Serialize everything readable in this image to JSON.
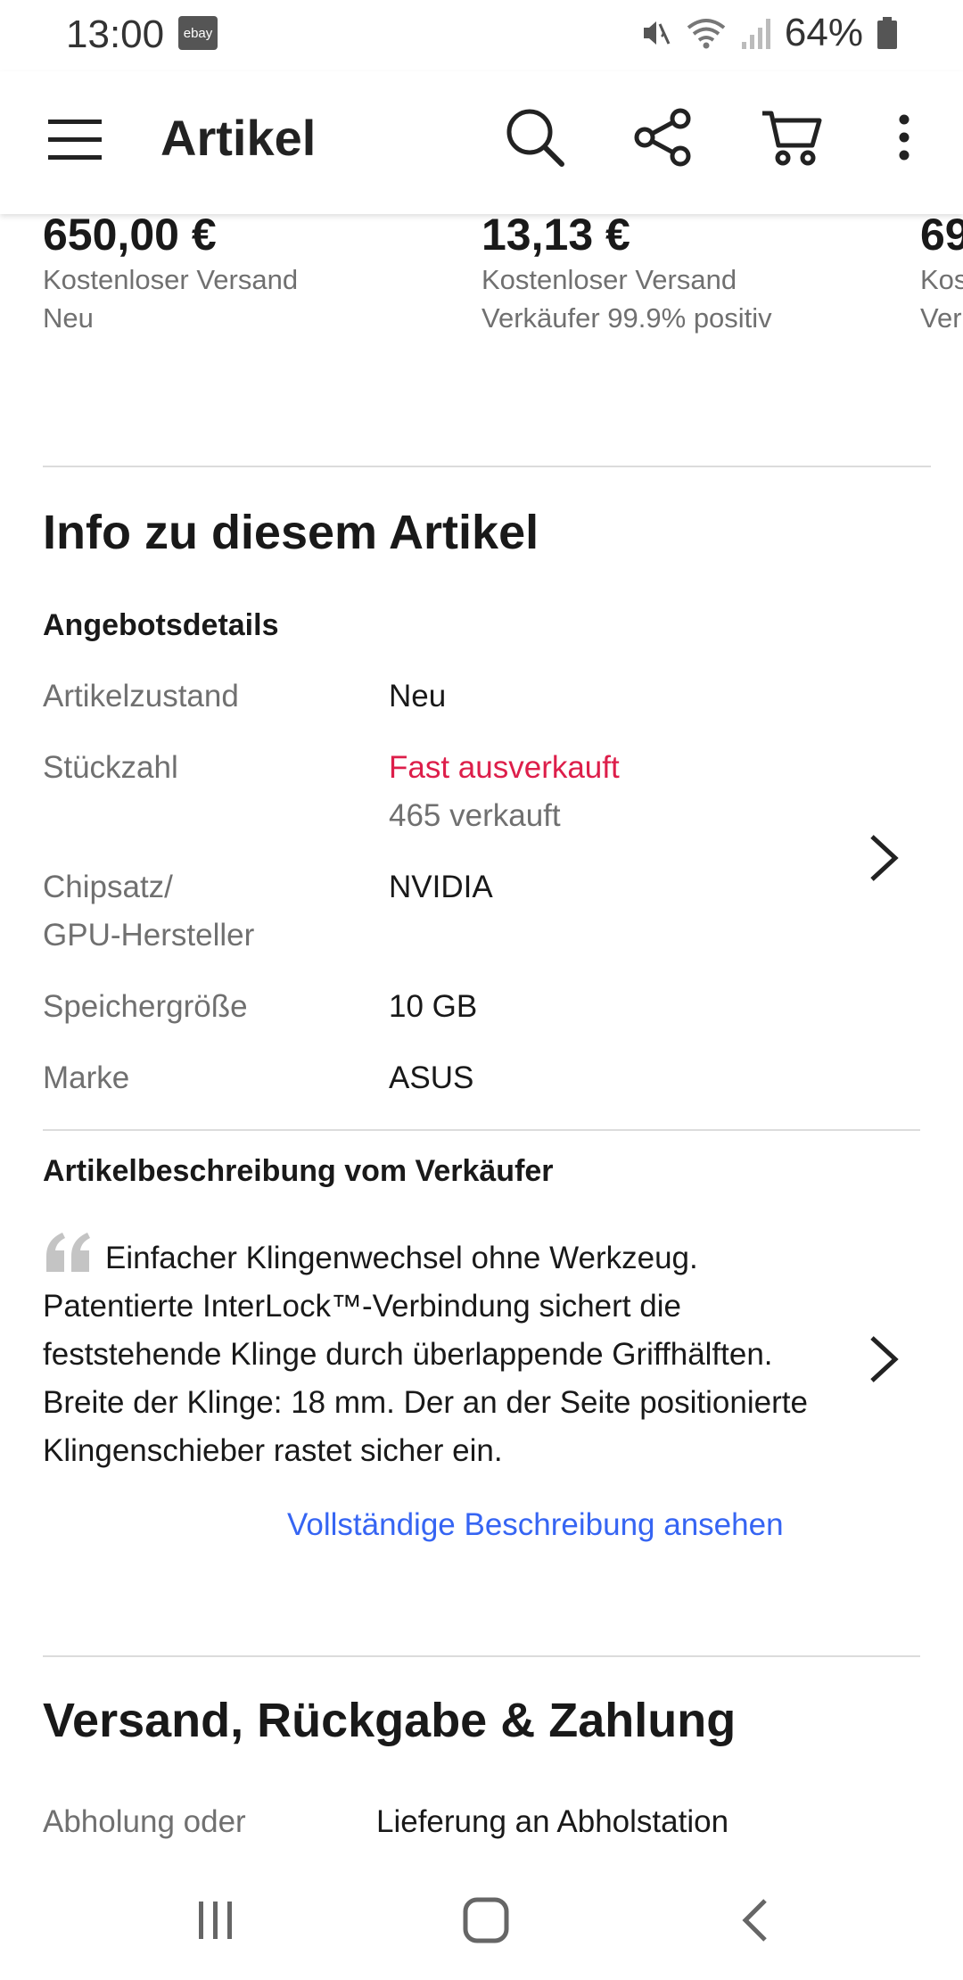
{
  "status_bar": {
    "time": "13:00",
    "ebay_badge": "ebay",
    "battery": "64%",
    "icons": [
      "mute-icon",
      "wifi-icon",
      "signal-icon",
      "battery-icon"
    ]
  },
  "app_bar": {
    "title": "Artikel",
    "icons": [
      "menu-icon",
      "search-icon",
      "share-icon",
      "cart-icon",
      "more-icon"
    ]
  },
  "similar_items": [
    {
      "price": "650,00 €",
      "line1": "Kostenloser Versand",
      "line2": "Neu"
    },
    {
      "price": "13,13 €",
      "line1": "Kostenloser Versand",
      "line2": "Verkäufer 99.9% positiv"
    },
    {
      "price": "69",
      "line1": "Kos",
      "line2": "Ver"
    }
  ],
  "info": {
    "title": "Info zu diesem Artikel",
    "offer_heading": "Angebotsdetails",
    "specs": [
      {
        "label": "Artikelzustand",
        "value": "Neu"
      },
      {
        "label": "Stückzahl",
        "value": "Fast ausverkauft",
        "value2": "465 verkauft"
      },
      {
        "label_line1": "Chipsatz/",
        "label_line2": "GPU-Hersteller",
        "value": "NVIDIA"
      },
      {
        "label": "Speichergröße",
        "value": "10 GB"
      },
      {
        "label": "Marke",
        "value": "ASUS"
      }
    ],
    "desc_heading": "Artikelbeschreibung vom Verkäufer",
    "desc_text": "Einfacher Klingenwechsel ohne Werkzeug. Patentierte InterLock™-Verbindung sichert die feststehende Klinge durch überlappende Griffhälften. Breite der Klinge: 18 mm. Der an der Seite positionierte Klingenschieber rastet sicher ein.",
    "desc_link": "Vollständige Beschreibung ansehen"
  },
  "shipping": {
    "title": "Versand, Rückgabe & Zahlung",
    "row_label": "Abholung oder",
    "row_value": "Lieferung an Abholstation"
  },
  "nav_bar": {
    "icons": [
      "recents-icon",
      "home-icon",
      "back-icon"
    ]
  },
  "colors": {
    "accent_link": "#3665f3",
    "stock_warning": "#dd1e4a",
    "secondary_text": "#707070",
    "primary_text": "#191919"
  }
}
